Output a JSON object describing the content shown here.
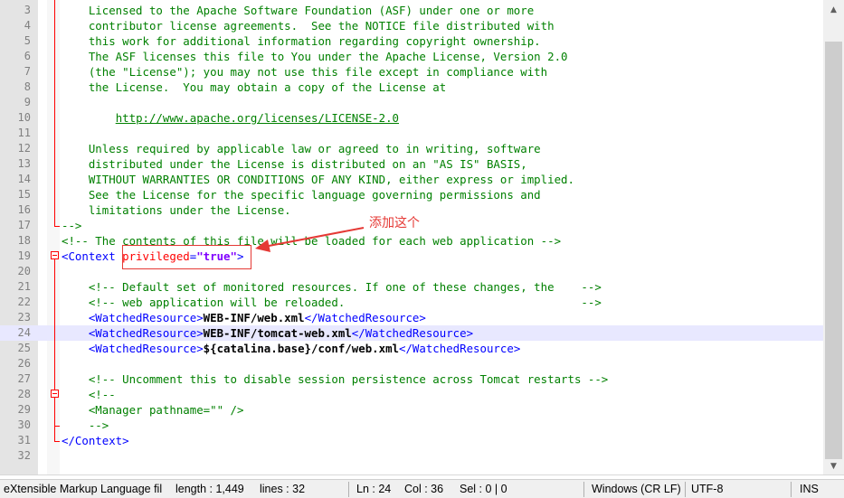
{
  "lines": [
    {
      "n": "3",
      "html": "<span class=\"c\">    Licensed to the Apache Software Foundation (ASF) under one or more</span>"
    },
    {
      "n": "4",
      "html": "<span class=\"c\">    contributor license agreements.  See the NOTICE file distributed with</span>"
    },
    {
      "n": "5",
      "html": "<span class=\"c\">    this work for additional information regarding copyright ownership.</span>"
    },
    {
      "n": "6",
      "html": "<span class=\"c\">    The ASF licenses this file to You under the Apache License, Version 2.0</span>"
    },
    {
      "n": "7",
      "html": "<span class=\"c\">    (the \"License\"); you may not use this file except in compliance with</span>"
    },
    {
      "n": "8",
      "html": "<span class=\"c\">    the License.  You may obtain a copy of the License at</span>"
    },
    {
      "n": "9",
      "html": ""
    },
    {
      "n": "10",
      "html": "<span class=\"c\">        </span><span class=\"url\">http://www.apache.org/licenses/LICENSE-2.0</span>"
    },
    {
      "n": "11",
      "html": ""
    },
    {
      "n": "12",
      "html": "<span class=\"c\">    Unless required by applicable law or agreed to in writing, software</span>"
    },
    {
      "n": "13",
      "html": "<span class=\"c\">    distributed under the License is distributed on an \"AS IS\" BASIS,</span>"
    },
    {
      "n": "14",
      "html": "<span class=\"c\">    WITHOUT WARRANTIES OR CONDITIONS OF ANY KIND, either express or implied.</span>"
    },
    {
      "n": "15",
      "html": "<span class=\"c\">    See the License for the specific language governing permissions and</span>"
    },
    {
      "n": "16",
      "html": "<span class=\"c\">    limitations under the License.</span>"
    },
    {
      "n": "17",
      "html": "<span class=\"c\">--&gt;</span>"
    },
    {
      "n": "18",
      "html": "<span class=\"c\">&lt;!-- The contents of this file will be loaded for each web application --&gt;</span>"
    },
    {
      "n": "19",
      "html": "<span class=\"tag\">&lt;Context </span><span class=\"attr\">privileged</span><span class=\"tag\">=</span><span class=\"val\">\"true\"</span><span class=\"tag\">&gt;</span>"
    },
    {
      "n": "20",
      "html": ""
    },
    {
      "n": "21",
      "html": "<span class=\"c\">    &lt;!-- Default set of monitored resources. If one of these changes, the    --&gt;</span>"
    },
    {
      "n": "22",
      "html": "<span class=\"c\">    &lt;!-- web application will be reloaded.                                   --&gt;</span>"
    },
    {
      "n": "23",
      "html": "<span class=\"tag\">    &lt;WatchedResource&gt;</span><span class=\"txt\">WEB-INF/web.xml</span><span class=\"tag\">&lt;/WatchedResource&gt;</span>"
    },
    {
      "n": "24",
      "html": "<span class=\"tag\">    &lt;WatchedResource&gt;</span><span class=\"txt\">WEB-INF/tomcat-web.xml</span><span class=\"tag\">&lt;/WatchedResource&gt;</span>"
    },
    {
      "n": "25",
      "html": "<span class=\"tag\">    &lt;WatchedResource&gt;</span><span class=\"txt\">${catalina.base}/conf/web.xml</span><span class=\"tag\">&lt;/WatchedResource&gt;</span>"
    },
    {
      "n": "26",
      "html": ""
    },
    {
      "n": "27",
      "html": "<span class=\"c\">    &lt;!-- Uncomment this to disable session persistence across Tomcat restarts --&gt;</span>"
    },
    {
      "n": "28",
      "html": "<span class=\"c\">    &lt;!--</span>"
    },
    {
      "n": "29",
      "html": "<span class=\"c\">    &lt;Manager pathname=\"\" /&gt;</span>"
    },
    {
      "n": "30",
      "html": "<span class=\"c\">    --&gt;</span>"
    },
    {
      "n": "31",
      "html": "<span class=\"tag\">&lt;/Context&gt;</span>"
    },
    {
      "n": "32",
      "html": ""
    }
  ],
  "annotation": "添加这个",
  "status": {
    "filetype": "eXtensible Markup Language fil",
    "length": "length : 1,449",
    "lines": "lines : 32",
    "ln": "Ln : 24",
    "col": "Col : 36",
    "sel": "Sel : 0 | 0",
    "eol": "Windows (CR LF)",
    "encoding": "UTF-8",
    "mode": "INS"
  },
  "scroll": {
    "up_icon": "▲",
    "down_icon": "▼"
  },
  "colors": {
    "comment": "#008000",
    "tag": "#0000ff",
    "attr": "#ff0000",
    "value": "#8000ff",
    "annotation": "#e53935"
  }
}
